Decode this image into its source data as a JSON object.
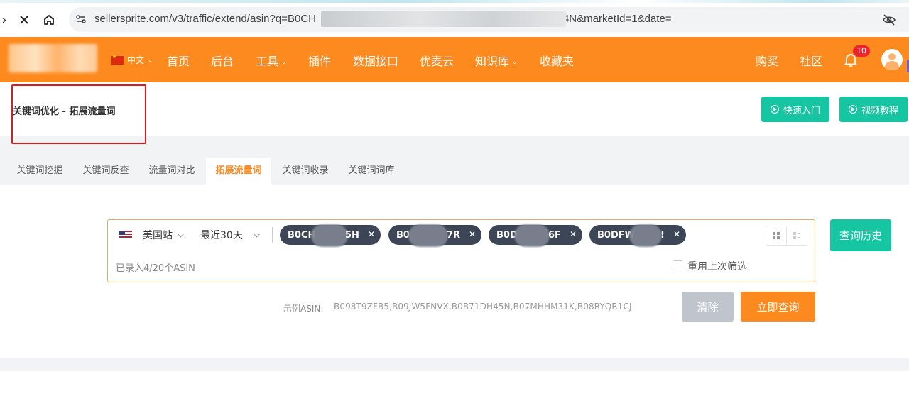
{
  "browser": {
    "url_prefix": "sellersprite.com/v3/traffic/extend/asin?q=B0CH",
    "url_suffix": "4N&marketId=1&date="
  },
  "header": {
    "lang": "中文",
    "nav": [
      {
        "label": "首页",
        "dropdown": false
      },
      {
        "label": "后台",
        "dropdown": false
      },
      {
        "label": "工具",
        "dropdown": true
      },
      {
        "label": "插件",
        "dropdown": false
      },
      {
        "label": "数据接口",
        "dropdown": false
      },
      {
        "label": "优麦云",
        "dropdown": false
      },
      {
        "label": "知识库",
        "dropdown": true
      },
      {
        "label": "收藏夹",
        "dropdown": false
      }
    ],
    "right_nav": [
      {
        "label": "购买"
      },
      {
        "label": "社区"
      }
    ],
    "notification_count": "10"
  },
  "page": {
    "title": "关键词优化 - 拓展流量词",
    "quick_start_label": "快速入门",
    "video_tutorial_label": "视频教程"
  },
  "tabs": [
    {
      "label": "关键词挖掘",
      "active": false
    },
    {
      "label": "关键词反查",
      "active": false
    },
    {
      "label": "流量词对比",
      "active": false
    },
    {
      "label": "拓展流量词",
      "active": true
    },
    {
      "label": "关键词收录",
      "active": false
    },
    {
      "label": "关键词词库",
      "active": false
    }
  ],
  "search": {
    "marketplace": "美国站",
    "date_range": "最近30天",
    "asin_chips": [
      {
        "text": "B0CH",
        "tail": "5H"
      },
      {
        "text": "B0",
        "tail": "7R"
      },
      {
        "text": "B0D",
        "tail": "6F"
      },
      {
        "text": "B0DFW",
        "tail": "!"
      }
    ],
    "count_text": "已录入4/20个ASIN",
    "reuse_filter_label": "重用上次筛选",
    "history_label": "查询历史",
    "example_label": "示例ASIN:",
    "example_value": "B098T9ZFB5,B09JW5FNVX,B0B71DH45N,B07MHHM31K,B08RYQR1CJ",
    "clear_label": "清除",
    "query_label": "立即查询"
  },
  "colors": {
    "brand_orange": "#fd8a1f",
    "teal": "#16c6a2",
    "highlight_red": "#e0191f"
  }
}
